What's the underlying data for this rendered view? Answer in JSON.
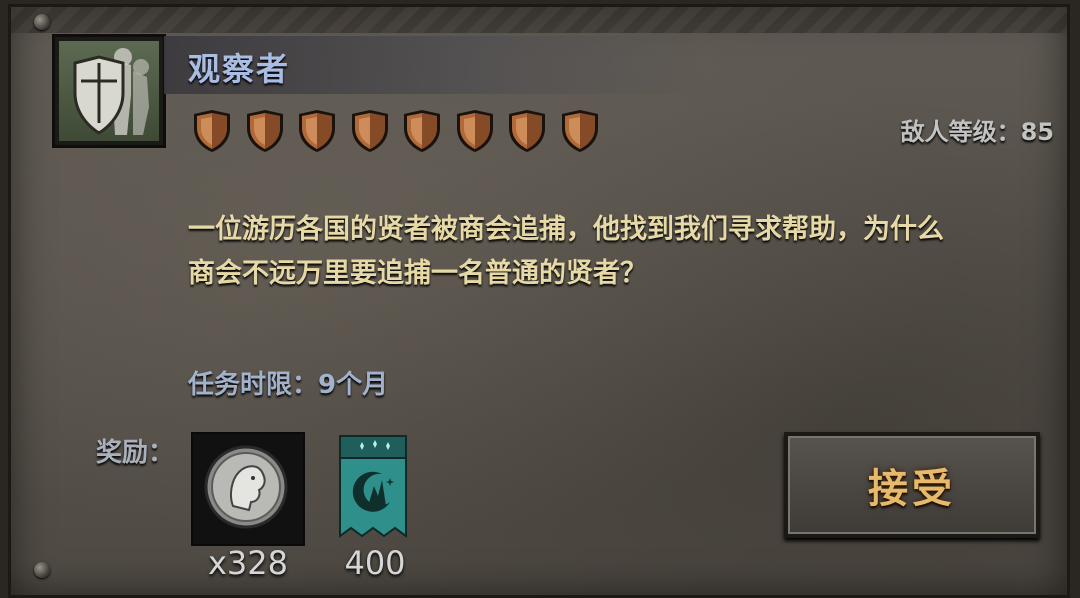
{
  "quest": {
    "title": "观察者",
    "difficulty_filled": 8,
    "enemy_level": "敌人等级：85",
    "description_line1": "一位游历各国的贤者被商会追捕，他找到我们寻求帮助，为什么",
    "description_line2": "商会不远万里要追捕一名普通的贤者？",
    "time_limit": "任务时限：9个月"
  },
  "rewards": {
    "label": "奖励：",
    "items": [
      {
        "icon": "silver-coin-icon",
        "quantity": "x328"
      },
      {
        "icon": "moon-banner-icon",
        "quantity": "400"
      }
    ]
  },
  "actions": {
    "accept_label": "接受"
  },
  "colors": {
    "title": "#a9bde2",
    "description": "#e7d9a6",
    "accept_text": "#e7b96c",
    "shield": "#b06a3a",
    "banner": "#2f8f8a"
  }
}
